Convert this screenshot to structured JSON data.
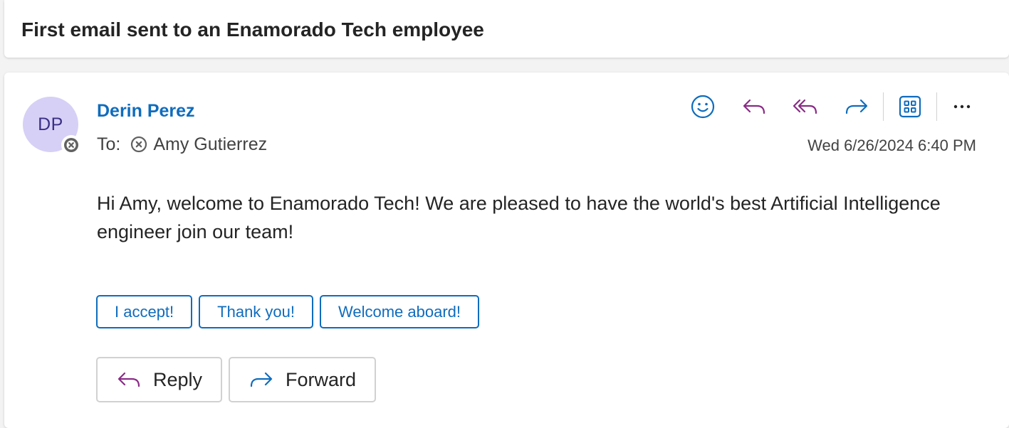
{
  "subject": "First email sent to an Enamorado Tech employee",
  "sender": {
    "initials": "DP",
    "name": "Derin Perez",
    "avatar_color": "#d6d0f6"
  },
  "recipients": {
    "label": "To:",
    "names": [
      "Amy Gutierrez"
    ]
  },
  "timestamp": "Wed 6/26/2024 6:40 PM",
  "body": "Hi Amy, welcome to Enamorado Tech! We are pleased to have the world's best Artificial Intelligence engineer join our team!",
  "toolbar": {
    "icons": [
      "emoji-icon",
      "reply-icon",
      "reply-all-icon",
      "forward-icon",
      "apps-icon",
      "more-icon"
    ]
  },
  "quick_replies": [
    "I accept!",
    "Thank you!",
    "Welcome aboard!"
  ],
  "actions": {
    "reply_label": "Reply",
    "forward_label": "Forward"
  },
  "colors": {
    "accent": "#0f6cbd",
    "reply_purple": "#8a2b86",
    "presence_gray": "#616161"
  }
}
